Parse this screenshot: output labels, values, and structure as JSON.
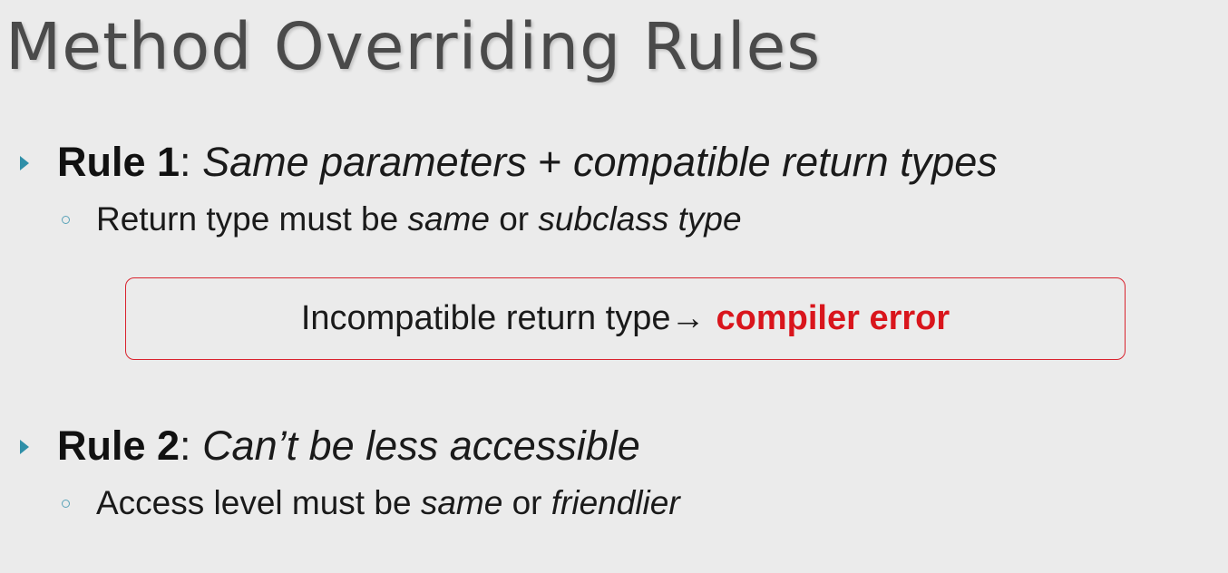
{
  "title": "Method Overriding Rules",
  "rule1": {
    "label": "Rule 1",
    "separator": ": ",
    "text_a": "Same parameters",
    "plus": " + ",
    "text_b": "compatible return types",
    "sub": {
      "t1": "Return type must be ",
      "i1": "same",
      "t2": " or ",
      "i2": "subclass type"
    }
  },
  "callout": {
    "text": "Incompatible return type ",
    "arrow": "→",
    "error": "compiler error"
  },
  "rule2": {
    "label": "Rule 2",
    "separator": ": ",
    "text": "Can’t be less accessible",
    "sub": {
      "t1": "Access level must be ",
      "i1": "same",
      "t2": " or ",
      "i2": "friendlier"
    }
  },
  "colors": {
    "accent_teal": "#2f8fa8",
    "error_red": "#d9151c",
    "title_gray": "#4a4a4a"
  }
}
